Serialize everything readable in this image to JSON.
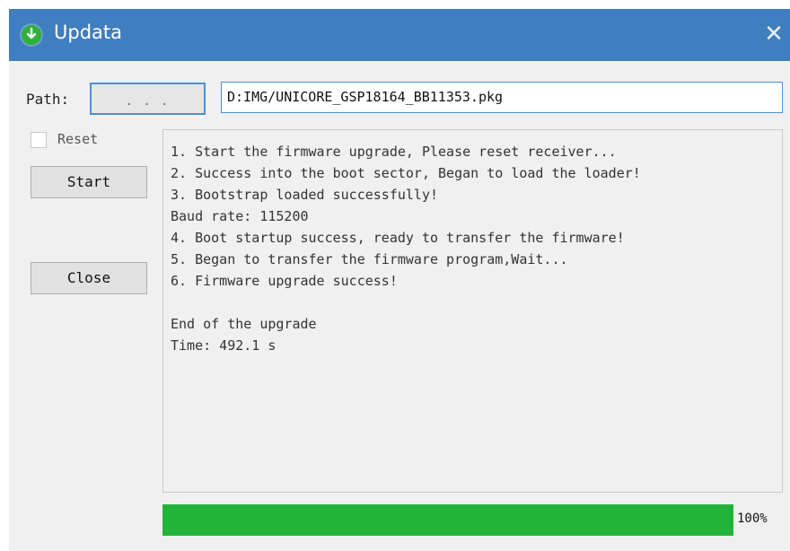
{
  "window": {
    "title": "Updata",
    "close_icon": "✕",
    "accent_color": "#3f7ebf"
  },
  "path": {
    "label": "Path:",
    "browse_label": ". . .",
    "value": "D:IMG/UNICORE_GSP18164_BB11353.pkg"
  },
  "controls": {
    "reset_label": "Reset",
    "reset_checked": false,
    "start_label": "Start",
    "close_label": "Close"
  },
  "log": {
    "lines": [
      "1. Start the firmware upgrade, Please reset receiver...",
      "2. Success into the boot sector, Began to load the loader!",
      "3. Bootstrap loaded successfully!",
      "Baud rate: 115200",
      "4. Boot startup success, ready to transfer the firmware!",
      "5. Began to transfer the firmware program,Wait...",
      "6. Firmware upgrade success!",
      "",
      "End of the upgrade",
      "Time: 492.1 s"
    ]
  },
  "progress": {
    "percent": 100,
    "label": "100%",
    "color": "#22b33a"
  }
}
